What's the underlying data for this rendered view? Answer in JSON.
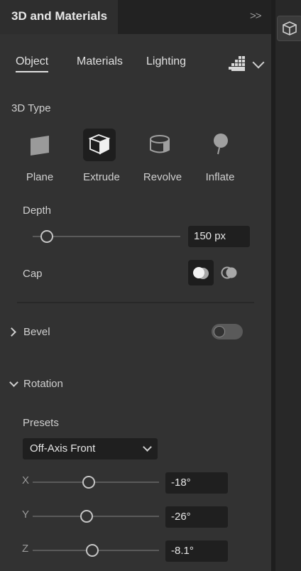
{
  "panel": {
    "title": "3D and Materials",
    "collapse_icon": "double-chevron-right-icon"
  },
  "tabs": [
    {
      "label": "Object",
      "active": true
    },
    {
      "label": "Materials",
      "active": false
    },
    {
      "label": "Lighting",
      "active": false
    }
  ],
  "type_section": {
    "label": "3D Type",
    "options": [
      {
        "label": "Plane",
        "icon": "plane-icon",
        "active": false
      },
      {
        "label": "Extrude",
        "icon": "extrude-icon",
        "active": true
      },
      {
        "label": "Revolve",
        "icon": "revolve-icon",
        "active": false
      },
      {
        "label": "Inflate",
        "icon": "inflate-icon",
        "active": false
      }
    ]
  },
  "depth": {
    "label": "Depth",
    "value": "150 px",
    "slider_fraction": 0.1
  },
  "cap": {
    "label": "Cap",
    "options": [
      {
        "icon": "cap-on-icon",
        "active": true
      },
      {
        "icon": "cap-off-icon",
        "active": false
      }
    ]
  },
  "bevel": {
    "label": "Bevel",
    "enabled": false
  },
  "rotation": {
    "label": "Rotation",
    "presets_label": "Presets",
    "preset_value": "Off-Axis Front",
    "axes": [
      {
        "axis": "X",
        "value": "-18°",
        "slider_fraction": 0.45
      },
      {
        "axis": "Y",
        "value": "-26°",
        "slider_fraction": 0.43
      },
      {
        "axis": "Z",
        "value": "-8.1°",
        "slider_fraction": 0.47
      }
    ]
  },
  "colors": {
    "panel_bg": "#323232",
    "field_bg": "#1f1f1f",
    "text": "#d6d6d6"
  }
}
